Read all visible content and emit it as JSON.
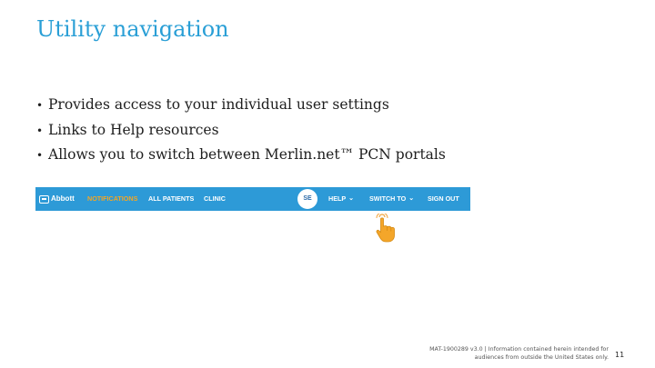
{
  "slide": {
    "title": "Utility navigation",
    "bullets": [
      "Provides access to your individual user settings",
      "Links to Help resources",
      "Allows you to switch between Merlin.net™ PCN portals"
    ],
    "bullet_char": "•"
  },
  "navbar": {
    "logo_text": "Abbott",
    "items": {
      "notifications": "NOTIFICATIONS",
      "all_patients": "ALL PATIENTS",
      "clinic": "CLINIC",
      "help": "HELP",
      "switch_to": "SWITCH TO",
      "sign_out": "SIGN OUT"
    },
    "user_initials": "SE",
    "chevron": "⌄",
    "colors": {
      "bar": "#2d9ad7",
      "active": "#f5a623",
      "text": "#ffffff"
    },
    "active_item": "notifications"
  },
  "pointer_icon": "hand-pointer-icon",
  "footer": {
    "note_line1": "MAT-1900289 v3.0 | Information contained herein intended for",
    "note_line2": "audiences from outside the United States only.",
    "page_number": "11"
  }
}
